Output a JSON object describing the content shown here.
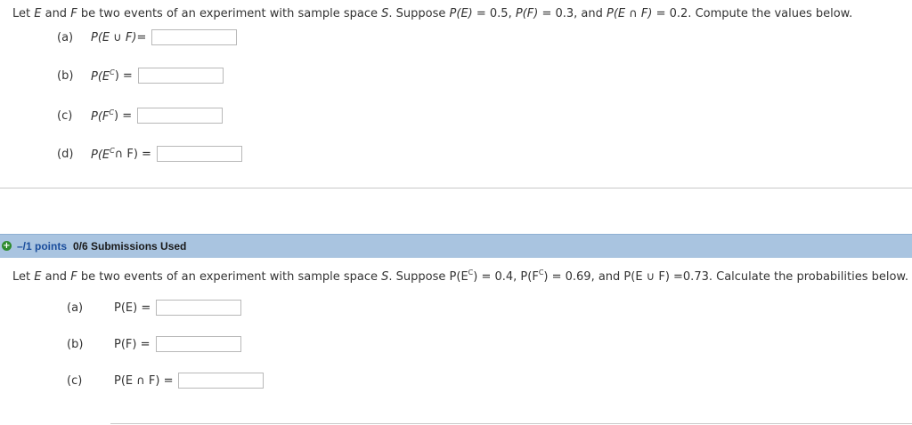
{
  "problem1": {
    "statement_parts": [
      "Let ",
      "E",
      " and ",
      "F",
      " be two events of an experiment with sample space ",
      "S",
      ". Suppose ",
      "P(E)",
      " = 0.5, ",
      "P(F)",
      " = 0.3, and ",
      "P(E ∩ F)",
      " = 0.2. Compute the values below."
    ],
    "questions": [
      {
        "label": "(a)",
        "expr": "P(E ∪ F)",
        "sup": "",
        "tail": " =",
        "value": ""
      },
      {
        "label": "(b)",
        "expr": "P(E",
        "sup": "C",
        "tail": ") =",
        "value": ""
      },
      {
        "label": "(c)",
        "expr": "P(F",
        "sup": "C",
        "tail": " ) =",
        "value": ""
      },
      {
        "label": "(d)",
        "expr": "P(E",
        "sup": "C",
        "tail": " ∩ F) =",
        "value": ""
      }
    ]
  },
  "problem2": {
    "header": {
      "icon": "plus-circle-icon",
      "points_label": "–/1 points",
      "submissions_label": "0/6 Submissions Used"
    },
    "statement_parts": [
      "Let ",
      "E",
      " and ",
      "F",
      " be two events of an experiment with sample space ",
      "S",
      ". Suppose ",
      "P(E",
      "C",
      ") = 0.4, ",
      "P(F",
      "C",
      ") = 0.69, and P(E ∪ F) =0.73. Calculate the probabilities below."
    ],
    "questions": [
      {
        "label": "(a)",
        "expr": "P(E) =",
        "value": ""
      },
      {
        "label": "(b)",
        "expr": "P(F) =",
        "value": ""
      },
      {
        "label": "(c)",
        "expr": "P(E ∩ F) =",
        "value": ""
      }
    ]
  },
  "colors": {
    "header_bar": "#a9c4e0",
    "points_text": "#1a4d9c",
    "plus_icon": "#2e8b2e",
    "divider": "#c9c9c9"
  }
}
